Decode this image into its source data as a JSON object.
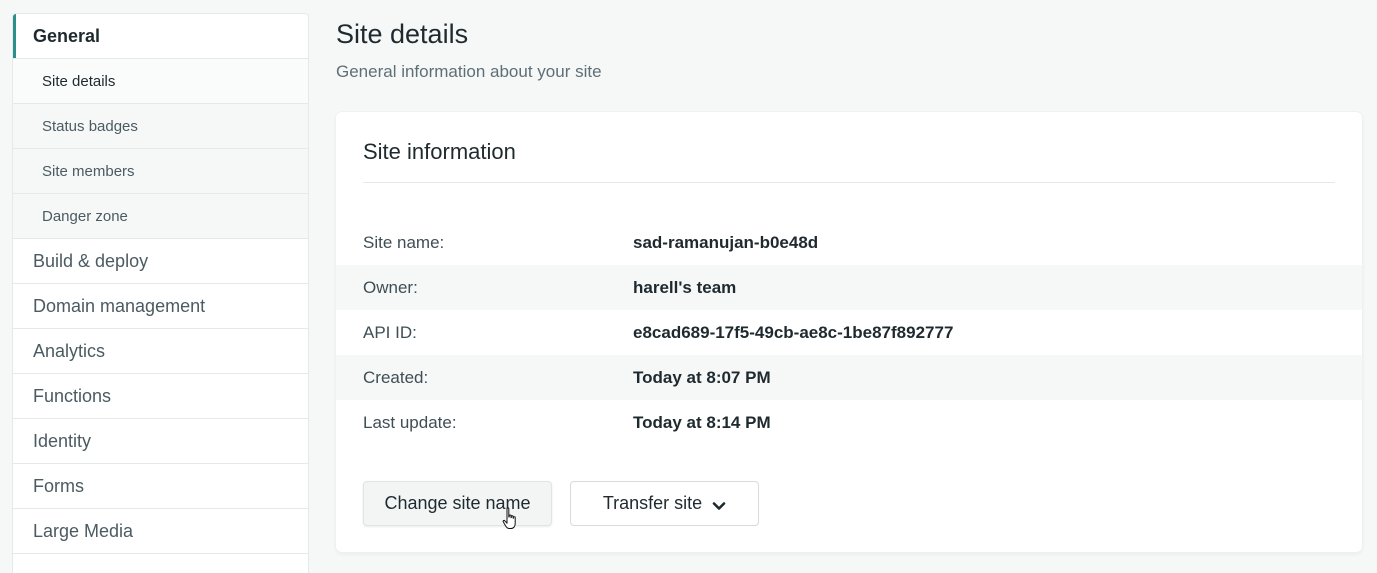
{
  "sidebar": {
    "sections": [
      {
        "label": "General",
        "active": true
      },
      {
        "label": "Build & deploy"
      },
      {
        "label": "Domain management"
      },
      {
        "label": "Analytics"
      },
      {
        "label": "Functions"
      },
      {
        "label": "Identity"
      },
      {
        "label": "Forms"
      },
      {
        "label": "Large Media"
      }
    ],
    "general_sub": [
      {
        "label": "Site details",
        "current": true
      },
      {
        "label": "Status badges"
      },
      {
        "label": "Site members"
      },
      {
        "label": "Danger zone"
      }
    ]
  },
  "header": {
    "title": "Site details",
    "subtitle": "General information about your site"
  },
  "card": {
    "title": "Site information",
    "rows": [
      {
        "label": "Site name:",
        "value": "sad-ramanujan-b0e48d"
      },
      {
        "label": "Owner:",
        "value": "harell's team"
      },
      {
        "label": "API ID:",
        "value": "e8cad689-17f5-49cb-ae8c-1be87f892777"
      },
      {
        "label": "Created:",
        "value": "Today at 8:07 PM"
      },
      {
        "label": "Last update:",
        "value": "Today at 8:14 PM"
      }
    ],
    "buttons": {
      "change_name": "Change site name",
      "transfer": "Transfer site"
    }
  },
  "icons": {
    "transfer_dropdown": "chevron-down-icon",
    "cursor": "hand-pointer-icon"
  },
  "colors": {
    "accent": "#2d8f8a",
    "background": "#f6f8f8"
  }
}
